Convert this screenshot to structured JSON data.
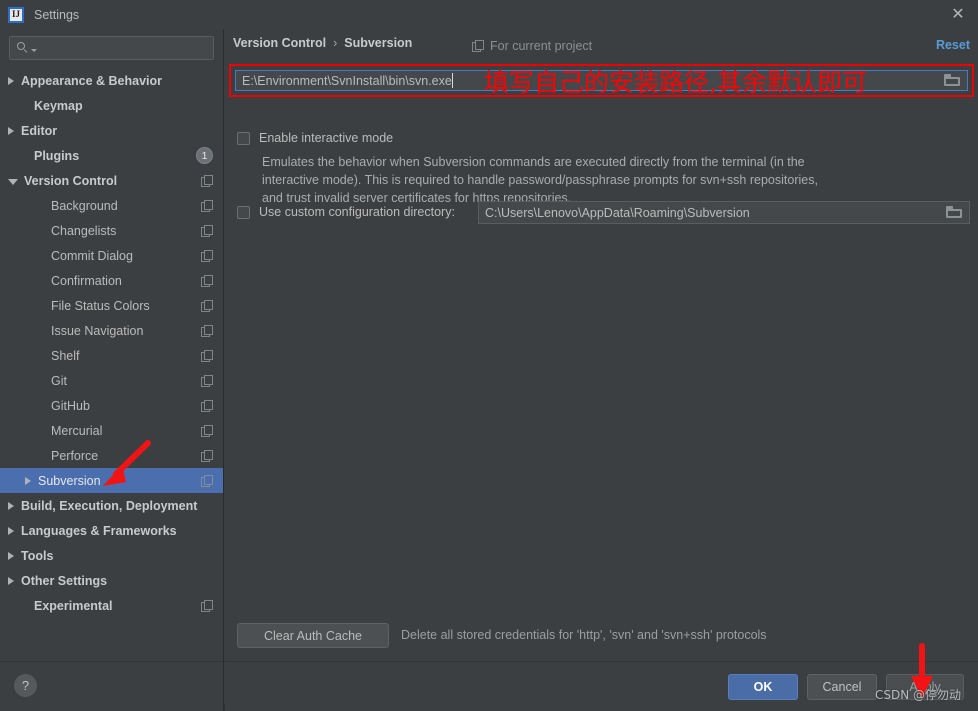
{
  "window": {
    "title": "Settings",
    "app_icon_text": "IJ",
    "close_icon": "close-icon"
  },
  "sidebar": {
    "search": {
      "value": "",
      "placeholder": ""
    },
    "items": [
      {
        "label": "Appearance & Behavior",
        "arrow": "right",
        "bold": true,
        "indent": 8,
        "trailing": "none"
      },
      {
        "label": "Keymap",
        "arrow": "none",
        "bold": true,
        "indent": 21,
        "trailing": "none"
      },
      {
        "label": "Editor",
        "arrow": "right",
        "bold": true,
        "indent": 8,
        "trailing": "none"
      },
      {
        "label": "Plugins",
        "arrow": "none",
        "bold": true,
        "indent": 21,
        "trailing": "badge",
        "badge": "1"
      },
      {
        "label": "Version Control",
        "arrow": "down",
        "bold": true,
        "indent": 8,
        "trailing": "copy"
      },
      {
        "label": "Background",
        "arrow": "none",
        "bold": false,
        "indent": 38,
        "trailing": "copy"
      },
      {
        "label": "Changelists",
        "arrow": "none",
        "bold": false,
        "indent": 38,
        "trailing": "copy"
      },
      {
        "label": "Commit Dialog",
        "arrow": "none",
        "bold": false,
        "indent": 38,
        "trailing": "copy"
      },
      {
        "label": "Confirmation",
        "arrow": "none",
        "bold": false,
        "indent": 38,
        "trailing": "copy"
      },
      {
        "label": "File Status Colors",
        "arrow": "none",
        "bold": false,
        "indent": 38,
        "trailing": "copy"
      },
      {
        "label": "Issue Navigation",
        "arrow": "none",
        "bold": false,
        "indent": 38,
        "trailing": "copy"
      },
      {
        "label": "Shelf",
        "arrow": "none",
        "bold": false,
        "indent": 38,
        "trailing": "copy"
      },
      {
        "label": "Git",
        "arrow": "none",
        "bold": false,
        "indent": 38,
        "trailing": "copy"
      },
      {
        "label": "GitHub",
        "arrow": "none",
        "bold": false,
        "indent": 38,
        "trailing": "copy"
      },
      {
        "label": "Mercurial",
        "arrow": "none",
        "bold": false,
        "indent": 38,
        "trailing": "copy"
      },
      {
        "label": "Perforce",
        "arrow": "none",
        "bold": false,
        "indent": 38,
        "trailing": "copy"
      },
      {
        "label": "Subversion",
        "arrow": "right",
        "bold": false,
        "indent": 25,
        "trailing": "copy",
        "selected": true
      },
      {
        "label": "Build, Execution, Deployment",
        "arrow": "right",
        "bold": true,
        "indent": 8,
        "trailing": "none"
      },
      {
        "label": "Languages & Frameworks",
        "arrow": "right",
        "bold": true,
        "indent": 8,
        "trailing": "none"
      },
      {
        "label": "Tools",
        "arrow": "right",
        "bold": true,
        "indent": 8,
        "trailing": "none"
      },
      {
        "label": "Other Settings",
        "arrow": "right",
        "bold": true,
        "indent": 8,
        "trailing": "none"
      },
      {
        "label": "Experimental",
        "arrow": "none",
        "bold": true,
        "indent": 21,
        "trailing": "copy"
      }
    ],
    "help_label": "?"
  },
  "main": {
    "breadcrumb": {
      "root": "Version Control",
      "separator": "›",
      "leaf": "Subversion"
    },
    "scope_label": "For current project",
    "reset_label": "Reset",
    "path_field": {
      "value": "E:\\Environment\\SvnInstall\\bin\\svn.exe",
      "browse_icon": "folder-icon"
    },
    "annotation": "填写自己的安装路径,其余默认即可",
    "interactive_mode": {
      "label": "Enable interactive mode",
      "checked": false,
      "description": "Emulates the behavior when Subversion commands are executed directly from the terminal (in the interactive mode).\nThis is required to handle password/passphrase prompts for svn+ssh repositories, and trust invalid server certificates for https repositories."
    },
    "custom_config": {
      "label": "Use custom configuration directory:",
      "checked": false,
      "value": "C:\\Users\\Lenovo\\AppData\\Roaming\\Subversion"
    },
    "clear_auth_cache": {
      "button_label": "Clear Auth Cache",
      "description": "Delete all stored credentials for 'http', 'svn' and 'svn+ssh' protocols"
    }
  },
  "footer": {
    "ok_label": "OK",
    "cancel_label": "Cancel",
    "apply_label": "Apply"
  },
  "watermark": "CSDN @停勿动",
  "colors": {
    "panel_bg": "#3c3f41",
    "selection_blue": "#4b6eaf",
    "ok_button": "#4a6da7",
    "link_blue": "#5a9bd5",
    "annotation_red": "#ff0000",
    "text": "#bbbbbb"
  }
}
